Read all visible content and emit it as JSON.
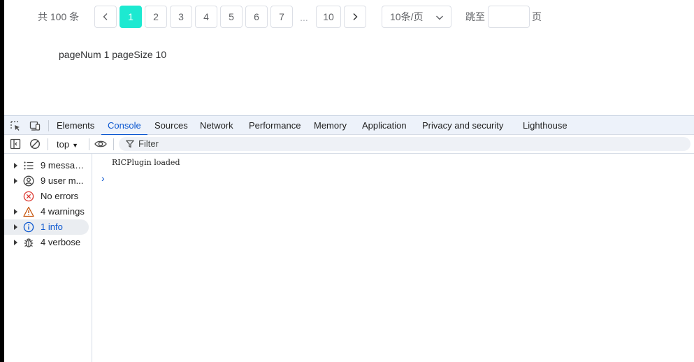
{
  "pagination": {
    "total_text": "共 100 条",
    "pages": [
      "1",
      "2",
      "3",
      "4",
      "5",
      "6",
      "7"
    ],
    "ellipsis": "...",
    "last_page": "10",
    "active_page": "1",
    "page_size_value": "10条/页",
    "jump_prefix": "跳至",
    "jump_suffix": "页",
    "jump_value": "",
    "active_color": "#1de9d1"
  },
  "page_info": "pageNum 1 pageSize 10",
  "devtools": {
    "tabs": [
      "Elements",
      "Console",
      "Sources",
      "Network",
      "Performance",
      "Memory",
      "Application",
      "Privacy and security",
      "Lighthouse"
    ],
    "selected_tab": "Console",
    "context": "top",
    "filter_placeholder": "Filter",
    "sidebar": [
      {
        "label": "9 messag...",
        "icon": "list-icon",
        "expandable": true
      },
      {
        "label": "9 user m...",
        "icon": "user-icon",
        "expandable": true
      },
      {
        "label": "No errors",
        "icon": "error-icon",
        "expandable": false
      },
      {
        "label": "4 warnings",
        "icon": "warning-icon",
        "expandable": true
      },
      {
        "label": "1 info",
        "icon": "info-icon",
        "expandable": true,
        "selected": true
      },
      {
        "label": "4 verbose",
        "icon": "bug-icon",
        "expandable": true
      }
    ],
    "console_messages": [
      "RICPlugin loaded"
    ],
    "accent_color": "#0b57d0"
  }
}
